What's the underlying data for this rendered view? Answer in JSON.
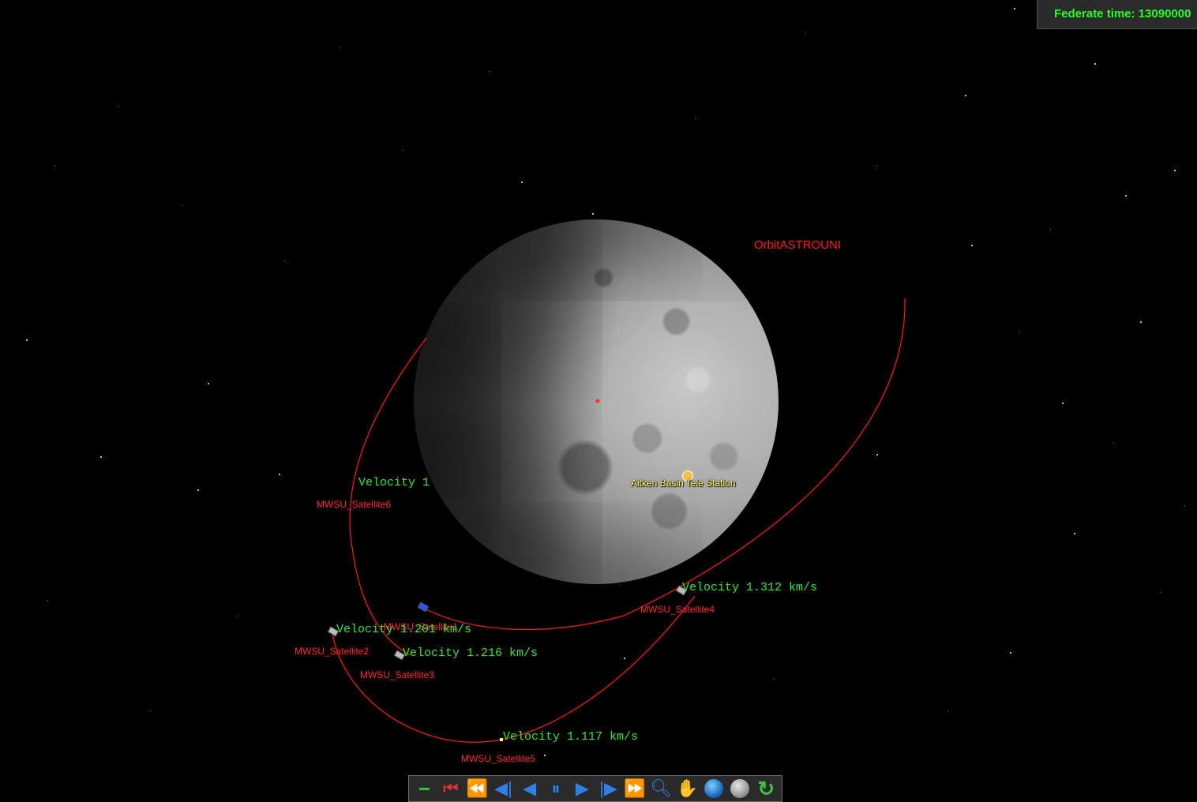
{
  "federate_time": {
    "label": "Federate time: 13090000"
  },
  "orbit_title": "OrbitASTROUNI",
  "station": {
    "label": "Aitken Basin Tele Station"
  },
  "satellites": [
    {
      "name": "MWSU_Satellite6",
      "velocity": "Velocity 1"
    },
    {
      "name": "MWSU_Satellite1",
      "velocity": ""
    },
    {
      "name": "MWSU_Satellite2",
      "velocity": "Velocity 1.201 km/s"
    },
    {
      "name": "MWSU_Satellite3",
      "velocity": "Velocity 1.216 km/s"
    },
    {
      "name": "MWSU_Satellite4",
      "velocity": "Velocity 1.312 km/s"
    },
    {
      "name": "MWSU_Satellite5",
      "velocity": "Velocity 1.117 km/s"
    }
  ],
  "colors": {
    "orbit": "#ff1a1a",
    "velocity_text": "#2fe82f",
    "satellite_label": "#ff2a2a",
    "federate_time_text": "#25ff25"
  },
  "toolbar": {
    "buttons": [
      {
        "name": "zoom-out",
        "icon": "minus-icon"
      },
      {
        "name": "go-to-start",
        "icon": "skip-to-start-icon"
      },
      {
        "name": "fast-rewind",
        "icon": "fast-rewind-icon"
      },
      {
        "name": "step-back",
        "icon": "step-back-icon"
      },
      {
        "name": "play-reverse",
        "icon": "play-reverse-icon"
      },
      {
        "name": "pause",
        "icon": "pause-icon"
      },
      {
        "name": "play",
        "icon": "play-icon"
      },
      {
        "name": "step-forward",
        "icon": "step-forward-icon"
      },
      {
        "name": "fast-forward",
        "icon": "fast-forward-icon"
      },
      {
        "name": "zoom",
        "icon": "magnifier-icon"
      },
      {
        "name": "pan",
        "icon": "hand-icon"
      },
      {
        "name": "earth-view",
        "icon": "earth-globe-icon"
      },
      {
        "name": "moon-view",
        "icon": "moon-globe-icon"
      },
      {
        "name": "refresh",
        "icon": "refresh-icon"
      }
    ]
  }
}
